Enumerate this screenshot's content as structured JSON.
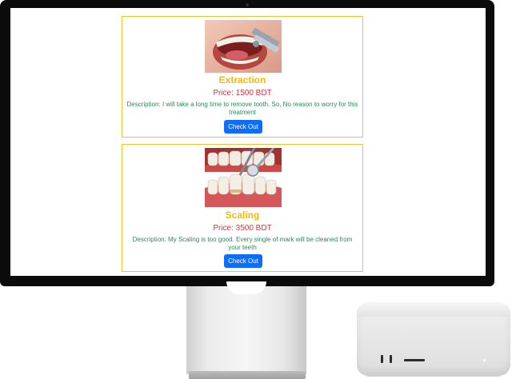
{
  "services": [
    {
      "title": "Extraction",
      "price": "Price: 1500 BDT",
      "description": "Description: I will take a long time to remove tooth. So, No reason to worry for this treatment",
      "button_label": "Check Out",
      "image_icon": "tooth-extraction-photo"
    },
    {
      "title": "Scaling",
      "price": "Price: 3500 BDT",
      "description": "Description: My Scaling is too good. Every single of mark will be cleaned from your teeth",
      "button_label": "Check Out",
      "image_icon": "teeth-scaling-photo"
    }
  ],
  "colors": {
    "title": "#f2b90f",
    "price": "#d9363e",
    "description": "#2e8b57",
    "button": "#0d6efd",
    "card_border": "#f2c230"
  }
}
